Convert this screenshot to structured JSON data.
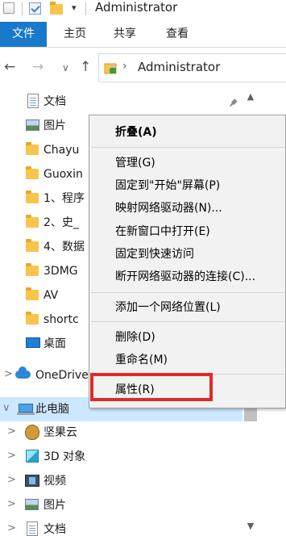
{
  "window": {
    "title": "Administrator"
  },
  "quick_access": {
    "icons": [
      "properties-icon",
      "checkbox-icon",
      "folder-icon",
      "dropdown-arrow-icon"
    ],
    "dropdown_glyph": "▾"
  },
  "ribbon": {
    "tabs": [
      "文件",
      "主页",
      "共享",
      "查看"
    ],
    "active_tab": "文件",
    "accent": "#1979ca"
  },
  "nav": {
    "back": "←",
    "forward": "→",
    "recent": "∨",
    "up": "↑"
  },
  "address": {
    "chevron": "›",
    "path": "Administrator"
  },
  "navpane": {
    "pin": "📌",
    "items": [
      {
        "label": "文档",
        "icon": "documents-icon",
        "expand": ""
      },
      {
        "label": "图片",
        "icon": "pictures-icon",
        "expand": ""
      },
      {
        "label": "Chayu",
        "icon": "folder-icon",
        "expand": ""
      },
      {
        "label": "Guoxin",
        "icon": "folder-icon",
        "expand": ""
      },
      {
        "label": "1、程序",
        "icon": "folder-icon",
        "expand": ""
      },
      {
        "label": "2、史_",
        "icon": "folder-icon",
        "expand": ""
      },
      {
        "label": "4、数据",
        "icon": "folder-icon",
        "expand": ""
      },
      {
        "label": "3DMG",
        "icon": "folder-icon",
        "expand": ""
      },
      {
        "label": "AV",
        "icon": "folder-icon",
        "expand": ""
      },
      {
        "label": "shortc",
        "icon": "folder-icon",
        "expand": ""
      },
      {
        "label": "桌面",
        "icon": "desktop-icon",
        "expand": ""
      },
      {
        "label": "OneDrive",
        "icon": "onedrive-icon",
        "expand": ">"
      },
      {
        "label": "此电脑",
        "icon": "this-pc-icon",
        "expand": "∨"
      },
      {
        "label": "坚果云",
        "icon": "jianguoyun-icon",
        "expand": ">"
      },
      {
        "label": "3D 对象",
        "icon": "3d-objects-icon",
        "expand": ">"
      },
      {
        "label": "视频",
        "icon": "videos-icon",
        "expand": ">"
      },
      {
        "label": "图片",
        "icon": "pictures-icon",
        "expand": ">"
      },
      {
        "label": "文档",
        "icon": "documents-icon",
        "expand": ">"
      }
    ],
    "selected_label": "此电脑"
  },
  "scrollbar": {
    "up": "▲",
    "down": "▼"
  },
  "context_menu": {
    "items": [
      {
        "label": "折叠(A)",
        "bold": true
      },
      {
        "label": "管理(G)"
      },
      {
        "label": "固定到\"开始\"屏幕(P)"
      },
      {
        "label": "映射网络驱动器(N)..."
      },
      {
        "label": "在新窗口中打开(E)"
      },
      {
        "label": "固定到快速访问"
      },
      {
        "label": "断开网络驱动器的连接(C)..."
      },
      {
        "label": "添加一个网络位置(L)"
      },
      {
        "label": "删除(D)"
      },
      {
        "label": "重命名(M)"
      },
      {
        "label": "属性(R)"
      }
    ],
    "highlighted_item": "属性(R)",
    "highlight_color": "#e02a2a"
  }
}
